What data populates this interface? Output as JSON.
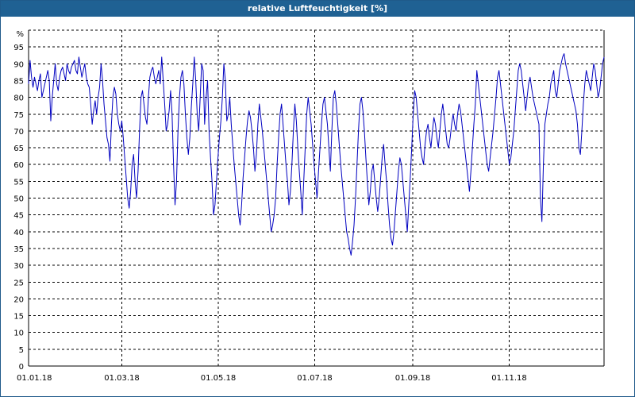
{
  "window": {
    "title": "relative Luftfeuchtigkeit [%]"
  },
  "chart_data": {
    "type": "line",
    "title": "relative Luftfeuchtigkeit [%]",
    "y_unit": "%",
    "ylim": [
      0,
      100
    ],
    "y_ticks": [
      0,
      5,
      10,
      15,
      20,
      25,
      30,
      35,
      40,
      45,
      50,
      55,
      60,
      65,
      70,
      75,
      80,
      85,
      90,
      95
    ],
    "x_tick_labels": [
      "01.01.18",
      "01.03.18",
      "01.05.18",
      "01.07.18",
      "01.09.18",
      "01.11.18"
    ],
    "x_tick_days": [
      0,
      59,
      120,
      181,
      243,
      304
    ],
    "grid": true,
    "series_color": "#0000c0",
    "series": [
      {
        "x_day_of_year": "0..364",
        "values": [
          84,
          91,
          86,
          83,
          86,
          84,
          82,
          85,
          87,
          80,
          82,
          84,
          86,
          88,
          85,
          73,
          80,
          85,
          90,
          84,
          82,
          86,
          88,
          89,
          87,
          85,
          90,
          88,
          87,
          89,
          90,
          91,
          88,
          87,
          92,
          89,
          86,
          88,
          90,
          86,
          84,
          83,
          78,
          72,
          76,
          79,
          75,
          80,
          83,
          90,
          85,
          78,
          73,
          68,
          66,
          61,
          72,
          80,
          83,
          81,
          75,
          72,
          70,
          73,
          68,
          62,
          56,
          50,
          47,
          52,
          60,
          63,
          55,
          50,
          58,
          70,
          80,
          82,
          78,
          74,
          72,
          80,
          86,
          88,
          89,
          86,
          84,
          86,
          88,
          84,
          92,
          85,
          78,
          70,
          72,
          76,
          82,
          75,
          60,
          48,
          55,
          70,
          80,
          86,
          88,
          84,
          75,
          68,
          63,
          68,
          77,
          84,
          92,
          85,
          75,
          70,
          80,
          90,
          88,
          72,
          80,
          85,
          70,
          62,
          55,
          45,
          48,
          55,
          62,
          68,
          73,
          80,
          90,
          85,
          73,
          75,
          80,
          72,
          66,
          60,
          55,
          50,
          45,
          42,
          48,
          56,
          62,
          68,
          73,
          76,
          74,
          70,
          65,
          58,
          63,
          72,
          78,
          74,
          70,
          65,
          60,
          55,
          50,
          45,
          40,
          42,
          45,
          50,
          60,
          68,
          75,
          78,
          72,
          66,
          60,
          55,
          48,
          52,
          60,
          70,
          78,
          73,
          65,
          58,
          52,
          45,
          55,
          65,
          75,
          80,
          76,
          72,
          66,
          60,
          55,
          50,
          58,
          65,
          72,
          78,
          80,
          76,
          72,
          65,
          58,
          70,
          80,
          82,
          78,
          72,
          66,
          60,
          55,
          50,
          45,
          40,
          38,
          35,
          33,
          37,
          42,
          50,
          60,
          70,
          78,
          80,
          76,
          70,
          62,
          55,
          48,
          52,
          58,
          60,
          55,
          50,
          46,
          50,
          56,
          62,
          66,
          60,
          55,
          48,
          42,
          38,
          36,
          40,
          46,
          52,
          58,
          62,
          60,
          55,
          50,
          45,
          40,
          48,
          56,
          65,
          75,
          82,
          80,
          75,
          70,
          65,
          62,
          60,
          66,
          70,
          72,
          68,
          65,
          70,
          74,
          72,
          68,
          65,
          70,
          75,
          78,
          74,
          70,
          66,
          65,
          68,
          72,
          75,
          72,
          70,
          75,
          78,
          76,
          72,
          68,
          64,
          60,
          56,
          52,
          58,
          65,
          72,
          78,
          88,
          84,
          80,
          76,
          72,
          68,
          64,
          60,
          58,
          62,
          66,
          70,
          75,
          80,
          86,
          88,
          84,
          80,
          76,
          72,
          68,
          64,
          60,
          62,
          66,
          70,
          76,
          82,
          88,
          90,
          88,
          84,
          80,
          76,
          80,
          84,
          86,
          83,
          80,
          78,
          76,
          74,
          72,
          50,
          43,
          60,
          72,
          75,
          78,
          80,
          84,
          86,
          88,
          82,
          80,
          84,
          88,
          90,
          92,
          93,
          90,
          88,
          86,
          84,
          82,
          80,
          78,
          76,
          72,
          65,
          63,
          70,
          78,
          84,
          88,
          86,
          84,
          82,
          86,
          90,
          88,
          84,
          80,
          82,
          86,
          90,
          92
        ]
      }
    ]
  }
}
